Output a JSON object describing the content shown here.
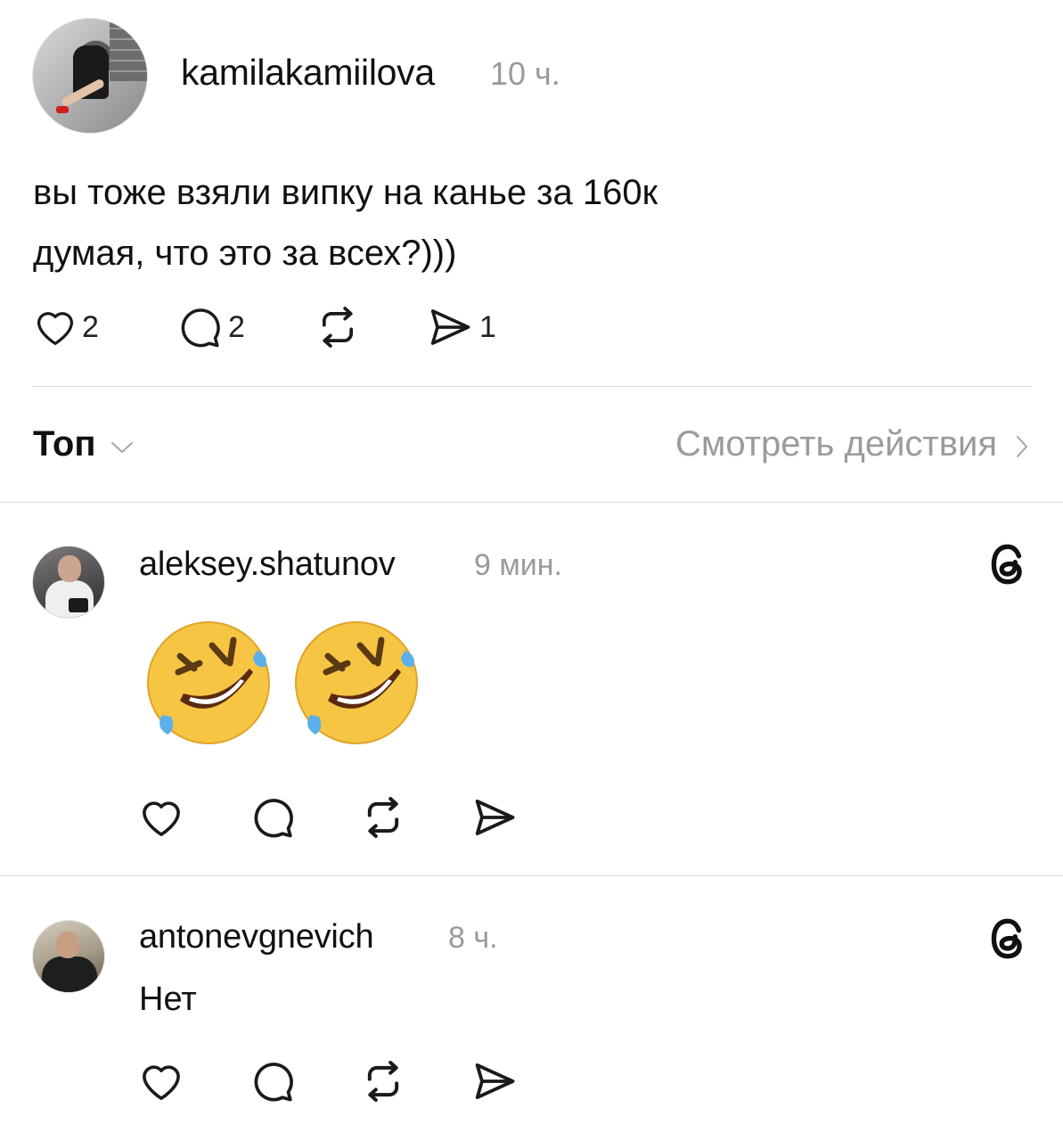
{
  "post": {
    "username": "kamilakamiilova",
    "time": "10 ч.",
    "text_line1": "вы тоже взяли випку на канье за 160к",
    "text_line2": "думая, что это за всех?)))",
    "likes": "2",
    "comments": "2",
    "shares": "1"
  },
  "sort": {
    "label": "Топ",
    "view_activity": "Смотреть действия"
  },
  "replies": [
    {
      "username": "aleksey.shatunov",
      "time": "9 мин.",
      "content": "🤣🤣",
      "emoji_count": 2
    },
    {
      "username": "antonevgnevich",
      "time": "8 ч.",
      "content": "Нет"
    }
  ],
  "icons": {
    "like": "heart-icon",
    "comment": "comment-bubble-icon",
    "repost": "repost-icon",
    "share": "send-icon",
    "threads": "threads-logo-icon"
  }
}
